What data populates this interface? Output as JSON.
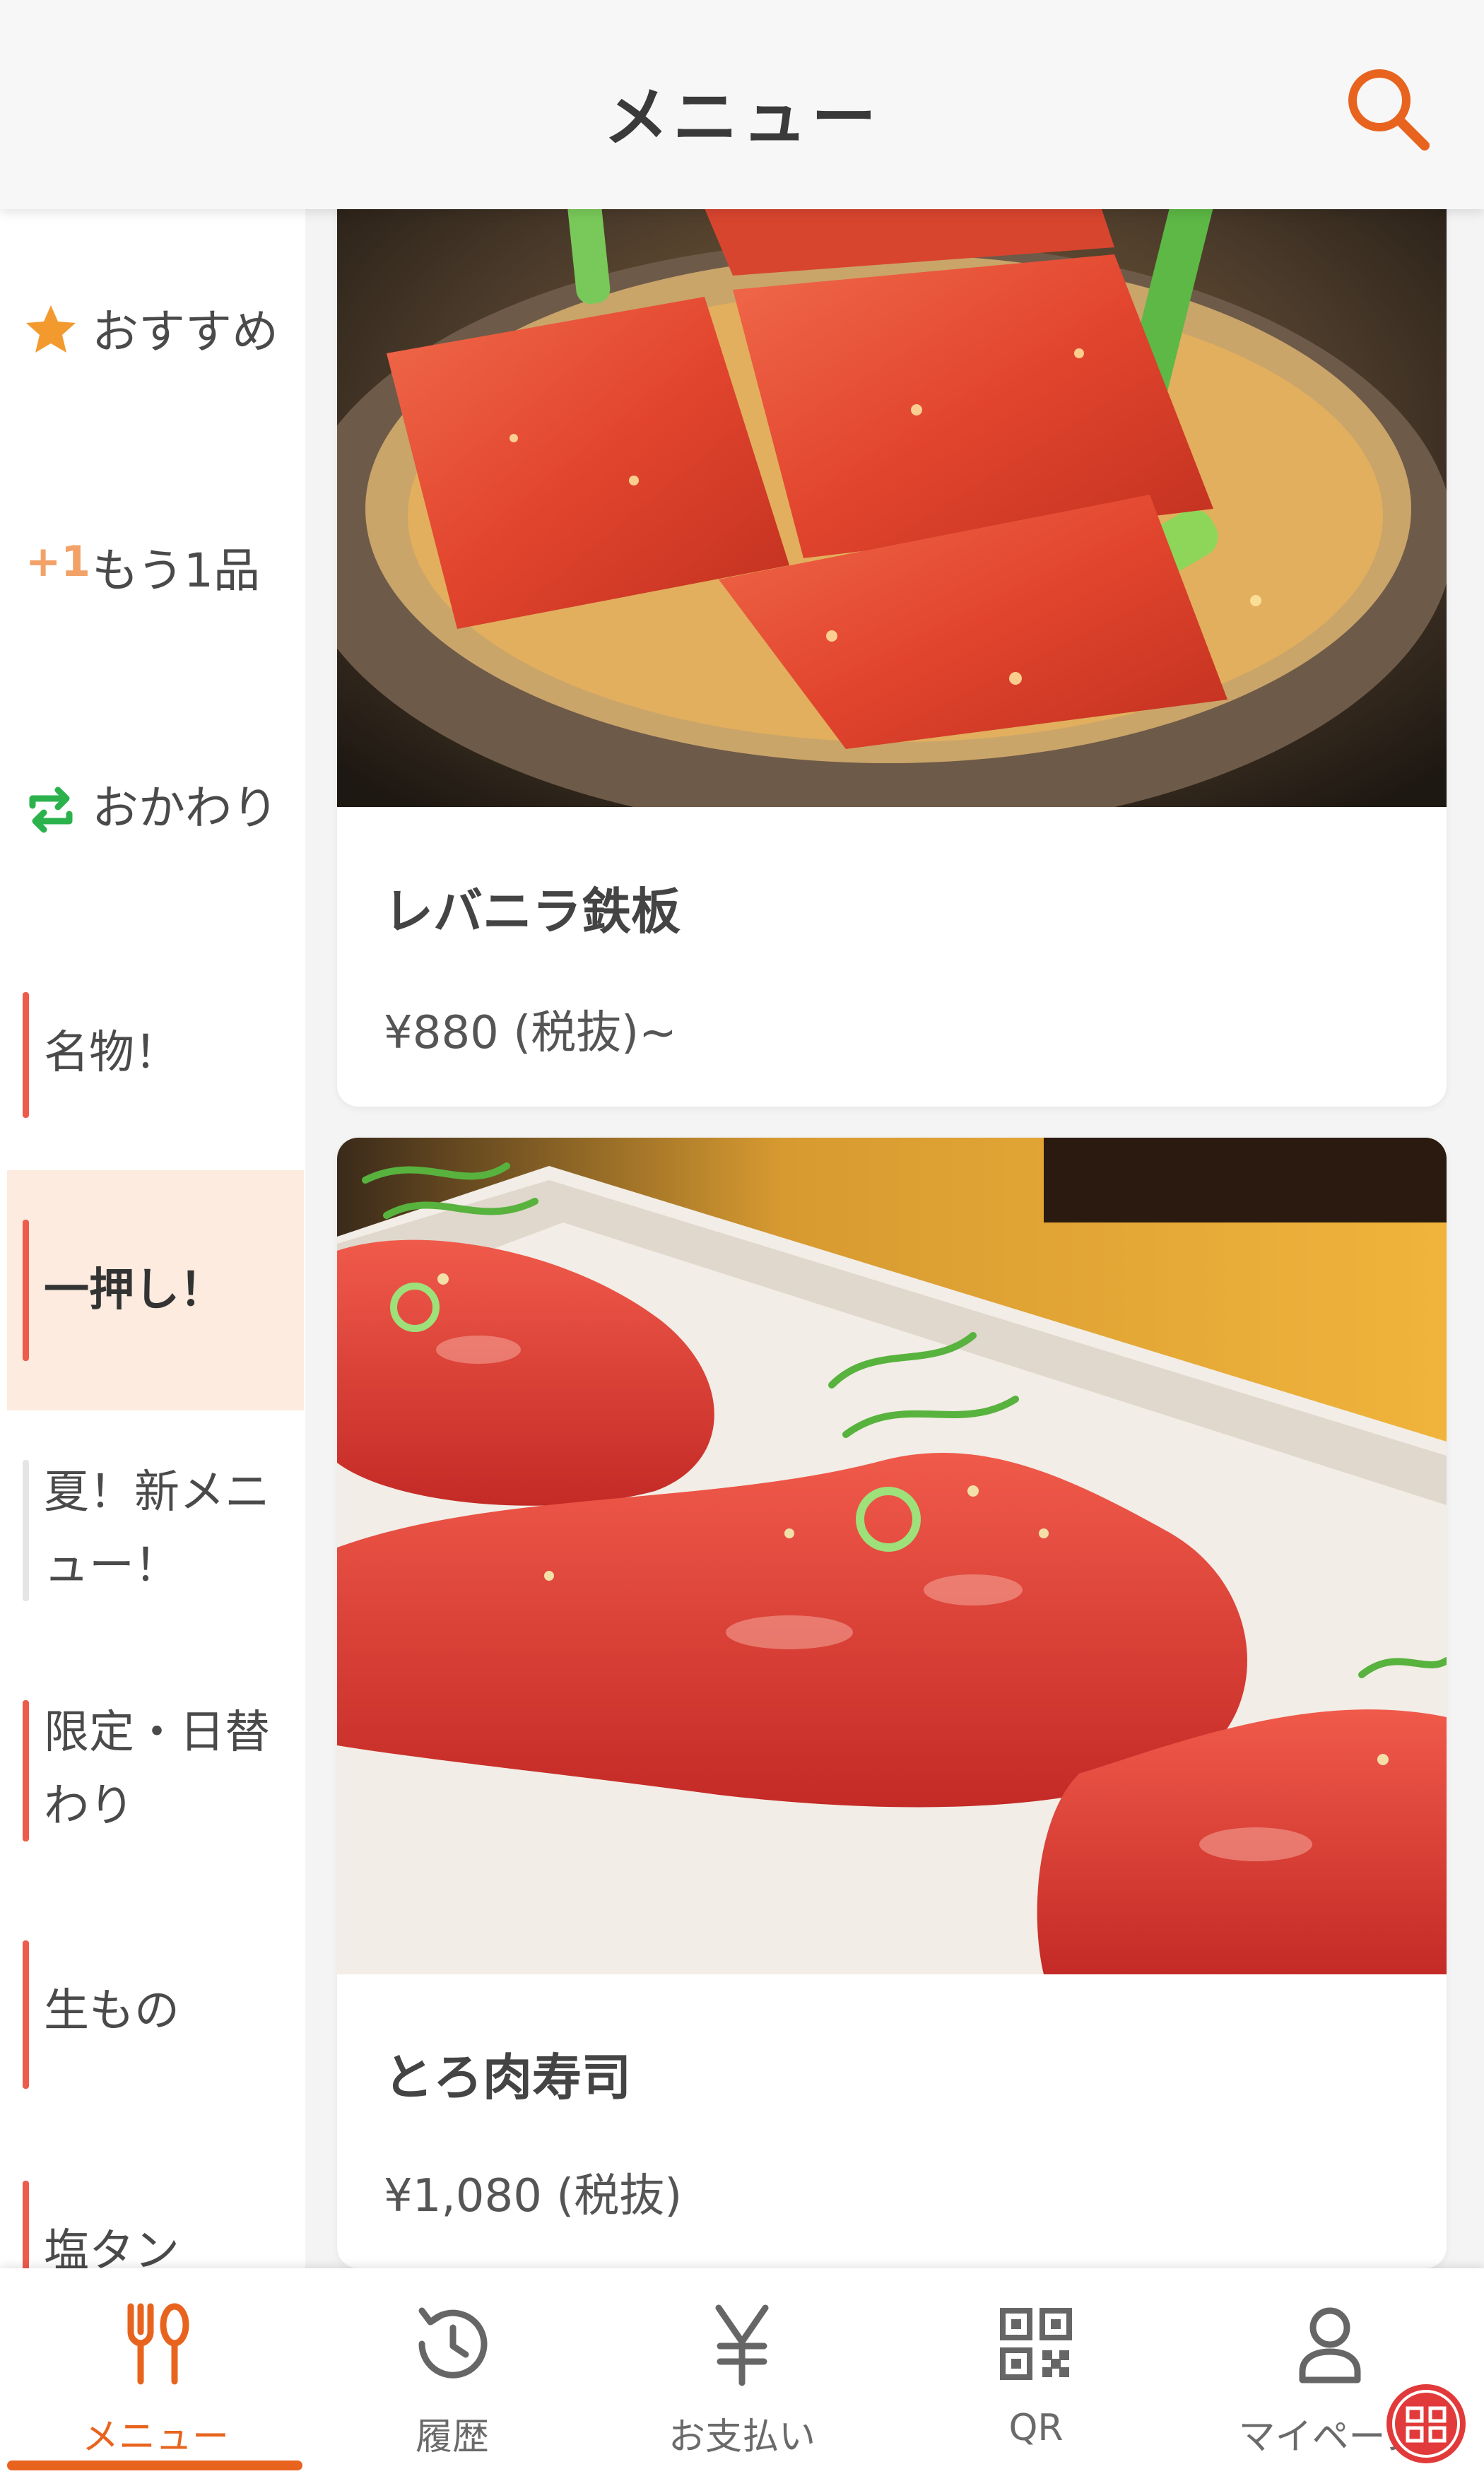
{
  "header": {
    "title": "メニュー",
    "search_icon": "search-icon"
  },
  "sidebar": {
    "items": [
      {
        "label": "おすすめ",
        "icon": "star-icon"
      },
      {
        "label": "もう1品",
        "icon": "plus-one-icon",
        "icon_text": "+1"
      },
      {
        "label": "おかわり",
        "icon": "refill-arrows-icon"
      },
      {
        "label": "名物！"
      },
      {
        "label": "一押し！",
        "active": true
      },
      {
        "label": "夏！新メニュー！"
      },
      {
        "label": "限定・日替わり"
      },
      {
        "label": "生もの"
      },
      {
        "label": "塩タン"
      }
    ]
  },
  "menu_items": [
    {
      "name": "レバニラ鉄板",
      "price": "¥880 (税抜)~",
      "image": "liver-and-chives-iron-plate-photo"
    },
    {
      "name": "とろ肉寿司",
      "price": "¥1,080 (税抜)",
      "image": "fatty-beef-sushi-photo"
    }
  ],
  "bottom_nav": {
    "items": [
      {
        "label": "メニュー",
        "icon": "fork-spoon-icon",
        "active": true
      },
      {
        "label": "履歴",
        "icon": "history-icon"
      },
      {
        "label": "お支払い",
        "icon": "yen-icon"
      },
      {
        "label": "QR",
        "icon": "qr-code-icon"
      },
      {
        "label": "マイページ",
        "icon": "person-icon"
      }
    ]
  },
  "colors": {
    "accent": "#e8641e",
    "category_bar": "#ee5b4a",
    "active_bg": "#fcebde",
    "refill_green": "#2bb24c",
    "star": "#f39a2e"
  }
}
